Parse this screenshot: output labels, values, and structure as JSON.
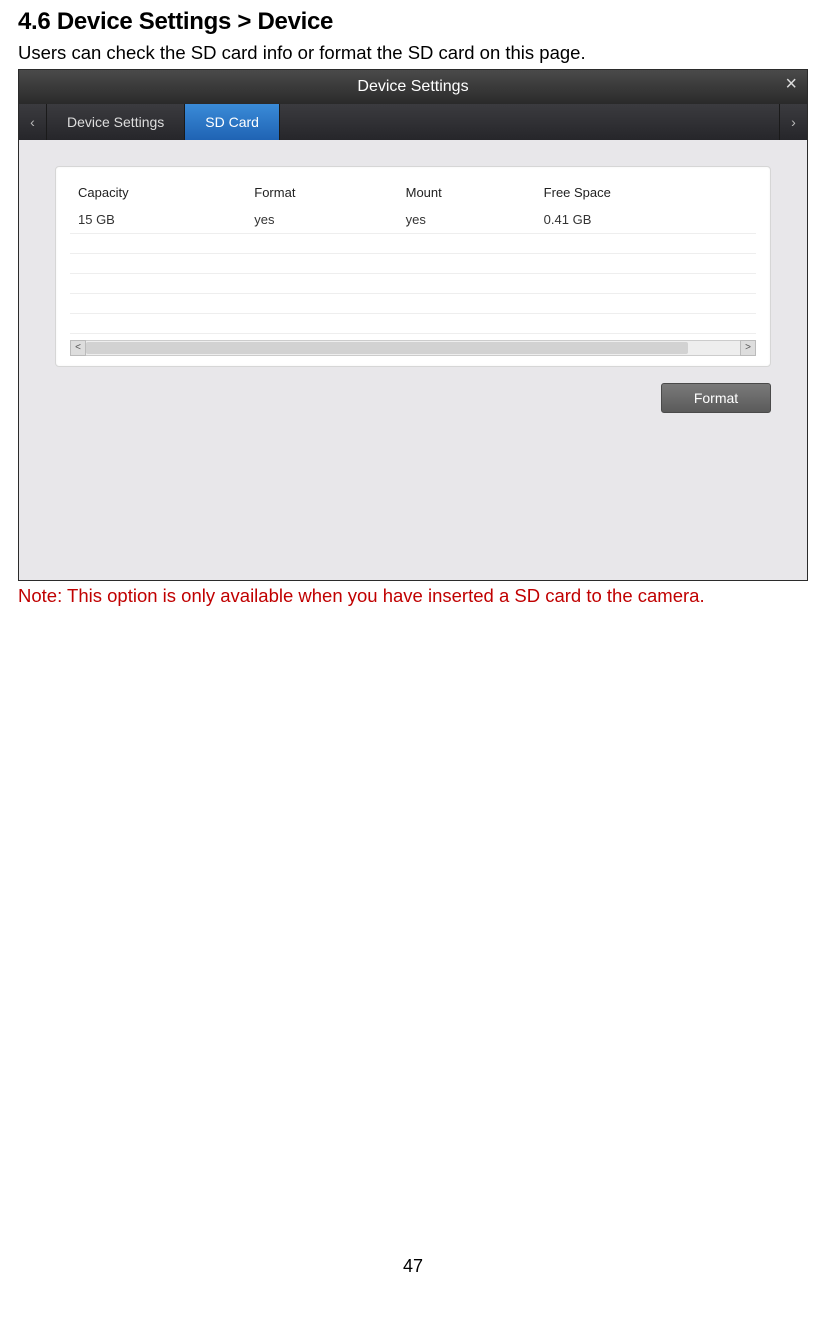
{
  "heading": "4.6 Device Settings > Device",
  "intro": "Users can check the SD card info or format the SD card on this page.",
  "dialog": {
    "title": "Device Settings",
    "tabs": {
      "deviceSettings": "Device Settings",
      "sdCard": "SD Card"
    },
    "table": {
      "headers": {
        "capacity": "Capacity",
        "format": "Format",
        "mount": "Mount",
        "freeSpace": "Free Space"
      },
      "row": {
        "capacity": "15 GB",
        "format": "yes",
        "mount": "yes",
        "freeSpace": "0.41 GB"
      }
    },
    "formatButton": "Format",
    "scrollLeft": "<",
    "scrollRight": ">"
  },
  "note": "Note: This option is only available when you have inserted a SD card to the camera.",
  "pageNumber": "47"
}
